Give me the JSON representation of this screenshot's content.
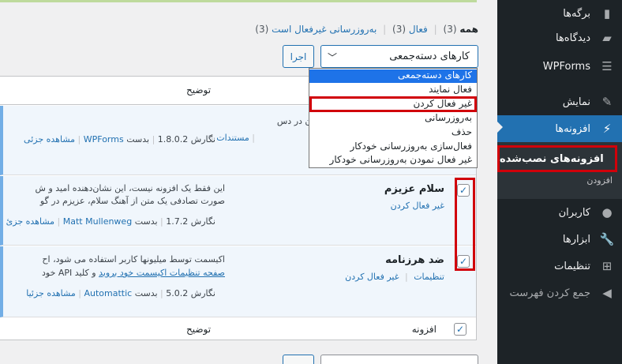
{
  "sidebar": {
    "items": [
      {
        "label": "برگه‌ها",
        "icon": "page-icon"
      },
      {
        "label": "دیدگاه‌ها",
        "icon": "comment-icon"
      },
      {
        "label": "WPForms",
        "icon": "wpforms-icon"
      },
      {
        "label": "نمایش",
        "icon": "brush-icon"
      },
      {
        "label": "افزونه‌ها",
        "icon": "plugin-icon"
      },
      {
        "label": "کاربران",
        "icon": "user-icon"
      },
      {
        "label": "ابزارها",
        "icon": "wrench-icon"
      },
      {
        "label": "تنظیمات",
        "icon": "settings-icon"
      },
      {
        "label": "جمع کردن فهرست",
        "icon": "collapse-icon"
      }
    ],
    "submenu": {
      "installed": "افزونه‌های نصب‌شده",
      "add": "افزودن"
    }
  },
  "filters": {
    "all": "همه",
    "all_count": "(3)",
    "active": "فعال",
    "active_count": "(3)",
    "auto_off": "به‌روزرسانی غیرفعال است",
    "auto_off_count": "(3)"
  },
  "bulk": {
    "selected": "کارهای دسته‌جمعی",
    "apply": "اجرا",
    "options": [
      "کارهای دسته‌جمعی",
      "فعال نمایند",
      "غیر فعال کردن",
      "به‌روزرسانی",
      "حذف",
      "فعال‌سازی به‌روزرسانی خودکار",
      "غیر فعال نمودن به‌روزرسانی خودکار"
    ]
  },
  "table": {
    "col_desc": "توضیح",
    "col_plugin": "افزونه",
    "rows": [
      {
        "desc": "ساده‌ترین و محبوب‌ترین فرمساز وردپرس جهان در دس",
        "links": "مستندات",
        "meta_version": "نگارش 1.8.0.2",
        "meta_by": "بدست",
        "author": "WPForms",
        "details": "مشاهده جزئی"
      },
      {
        "name": "سلام عزیزم",
        "action": "غیر فعال کردن",
        "desc1": "این فقط یک افزونه نیست، این نشان‌دهنده امید و ش",
        "desc2": "صورت تصادفی یک متن از آهنگ سلام، عزیزم در گو",
        "meta_version": "نگارش 1.7.2",
        "meta_by": "بدست",
        "author": "Matt Mullenweg",
        "details": "مشاهده جزئ"
      },
      {
        "name": "ضد هرزنامه",
        "action_settings": "تنظیمات",
        "action_deactivate": "غیر فعال کردن",
        "desc1": "اکیسمت توسط میلیونها کاربر استفاده می شود، اح",
        "desc2_link": "صفحه تنظیمات اکیسمت خود بروید",
        "desc2_rest": "و کلید API خود",
        "meta_version": "نگارش 5.0.2",
        "meta_by": "بدست",
        "author": "Automattic",
        "details": "مشاهده جزئیا"
      }
    ]
  }
}
